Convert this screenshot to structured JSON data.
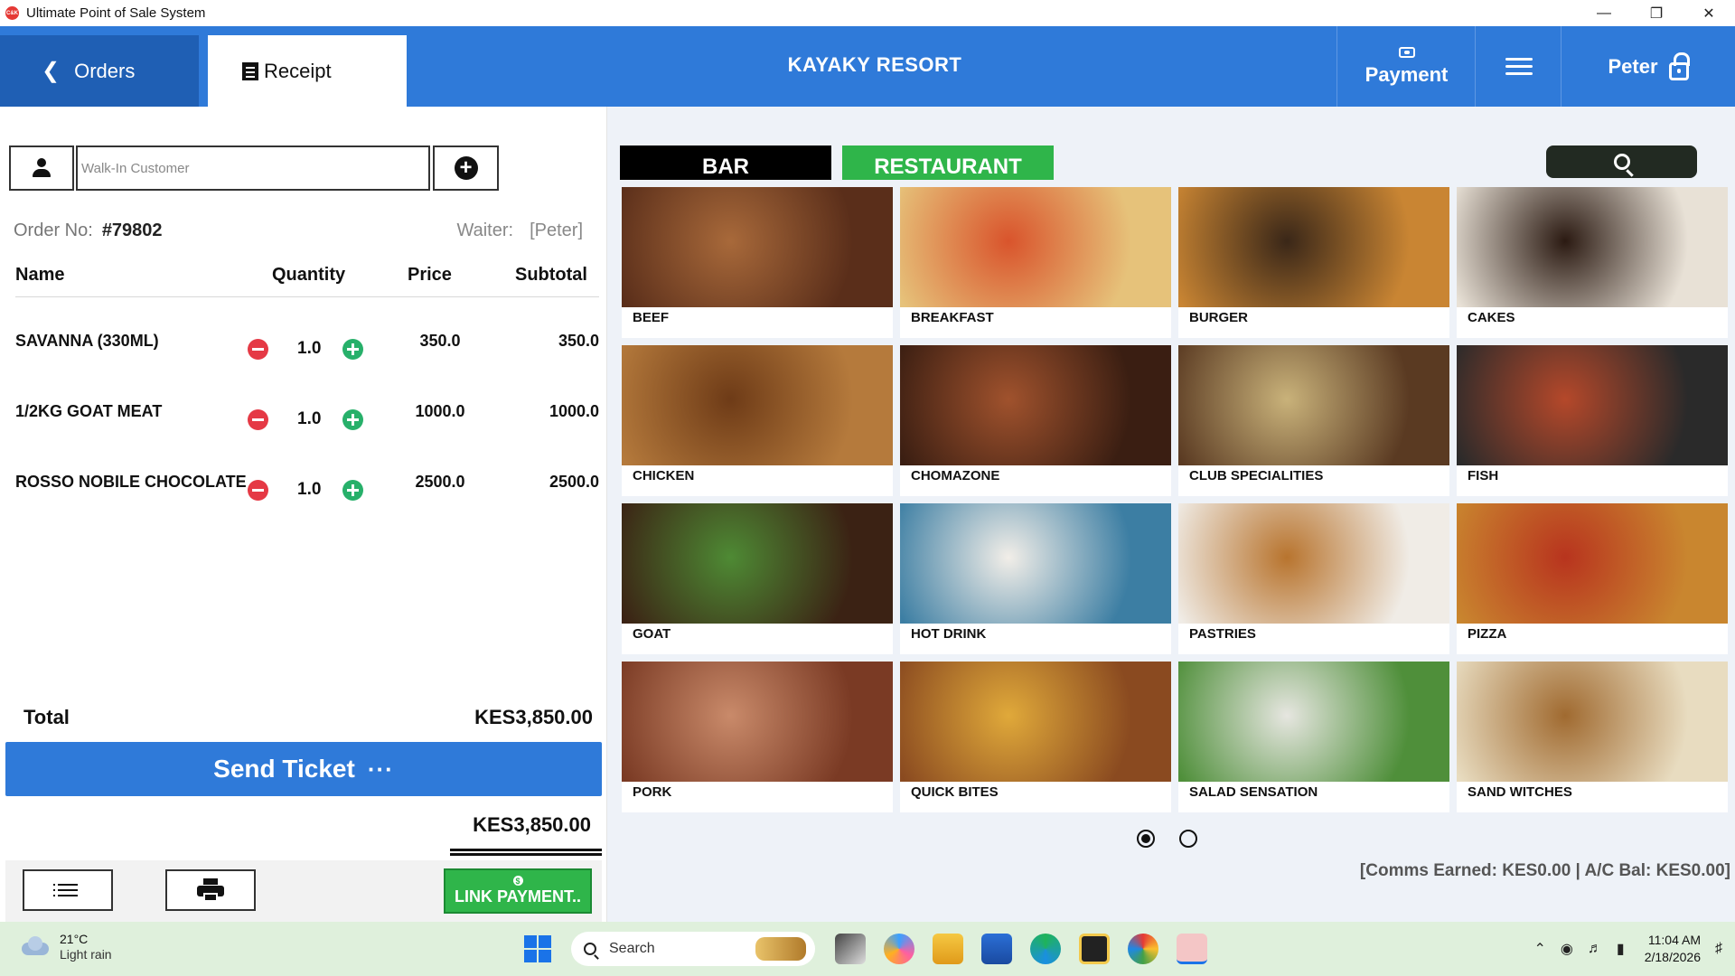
{
  "window": {
    "title": "Ultimate Point of Sale System",
    "app_icon_label": "C&K",
    "minimize": "—",
    "restore": "❐",
    "close": "✕"
  },
  "header": {
    "orders_tab": "Orders",
    "receipt_tab": "Receipt",
    "business_name": "KAYAKY RESORT",
    "payment_label": "Payment",
    "user_name": "Peter"
  },
  "customer": {
    "placeholder": "Walk-In Customer"
  },
  "order": {
    "order_no_label": "Order No:",
    "order_no": "#79802",
    "waiter_label": "Waiter:",
    "waiter_name": "[Peter]",
    "columns": [
      "Name",
      "Quantity",
      "Price",
      "Subtotal"
    ],
    "items": [
      {
        "name": "SAVANNA (330ML)",
        "qty": "1.0",
        "price": "350.0",
        "subtotal": "350.0"
      },
      {
        "name": "1/2KG  GOAT MEAT",
        "qty": "1.0",
        "price": "1000.0",
        "subtotal": "1000.0"
      },
      {
        "name": "ROSSO NOBILE CHOCOLATE",
        "qty": "1.0",
        "price": "2500.0",
        "subtotal": "2500.0"
      }
    ],
    "total_label": "Total",
    "total_value": "KES3,850.00",
    "send_ticket": "Send Ticket",
    "send_dots": "···",
    "amount_due": "KES3,850.00",
    "link_payment": "LINK PAYMENT..",
    "link_payment_coin": "$"
  },
  "categories": {
    "tabs": [
      "BAR",
      "RESTAURANT"
    ],
    "tab_colors": {
      "bar": "#000000",
      "restaurant": "#2fb54a"
    },
    "items": [
      {
        "name": "BEEF",
        "colors": [
          "#5a2e1a",
          "#a8693a"
        ]
      },
      {
        "name": "BREAKFAST",
        "colors": [
          "#e6c27a",
          "#d9542c"
        ]
      },
      {
        "name": "BURGER",
        "colors": [
          "#c98533",
          "#3a2718"
        ]
      },
      {
        "name": "CAKES",
        "colors": [
          "#e8e1d6",
          "#2b1a12"
        ]
      },
      {
        "name": "CHICKEN",
        "colors": [
          "#b57a3c",
          "#6e3b17"
        ]
      },
      {
        "name": "CHOMAZONE",
        "colors": [
          "#3a1e12",
          "#a0522d"
        ]
      },
      {
        "name": "CLUB SPECIALITIES",
        "colors": [
          "#5a3a22",
          "#c9b27a"
        ]
      },
      {
        "name": "FISH",
        "colors": [
          "#2a2a2a",
          "#b5482a"
        ]
      },
      {
        "name": "GOAT",
        "colors": [
          "#3b2214",
          "#4e8a34"
        ]
      },
      {
        "name": "HOT DRINK",
        "colors": [
          "#3c7ea3",
          "#f2eee8"
        ]
      },
      {
        "name": "PASTRIES",
        "colors": [
          "#f0ece6",
          "#b8742e"
        ]
      },
      {
        "name": "PIZZA",
        "colors": [
          "#c9862f",
          "#b8341e"
        ]
      },
      {
        "name": "PORK",
        "colors": [
          "#7a3a24",
          "#c98a6a"
        ]
      },
      {
        "name": "QUICK BITES",
        "colors": [
          "#8a4a20",
          "#e0a93a"
        ]
      },
      {
        "name": "SALAD SENSATION",
        "colors": [
          "#4f8f3a",
          "#e6e6e0"
        ]
      },
      {
        "name": "SAND WITCHES",
        "colors": [
          "#e8dcc0",
          "#a06a30"
        ]
      }
    ]
  },
  "pager": {
    "pages": 2,
    "current": 1
  },
  "status": {
    "comms": "[Comms Earned: KES0.00 | A/C Bal: KES0.00]"
  },
  "taskbar": {
    "temperature": "21°C",
    "weather": "Light rain",
    "search": "Search",
    "time": "11:04 AM",
    "date": "2/18/2026"
  },
  "colors": {
    "primary": "#2f7ad9",
    "primary_dark": "#1f5fb4",
    "green": "#2fb54a",
    "red": "#e53945"
  }
}
